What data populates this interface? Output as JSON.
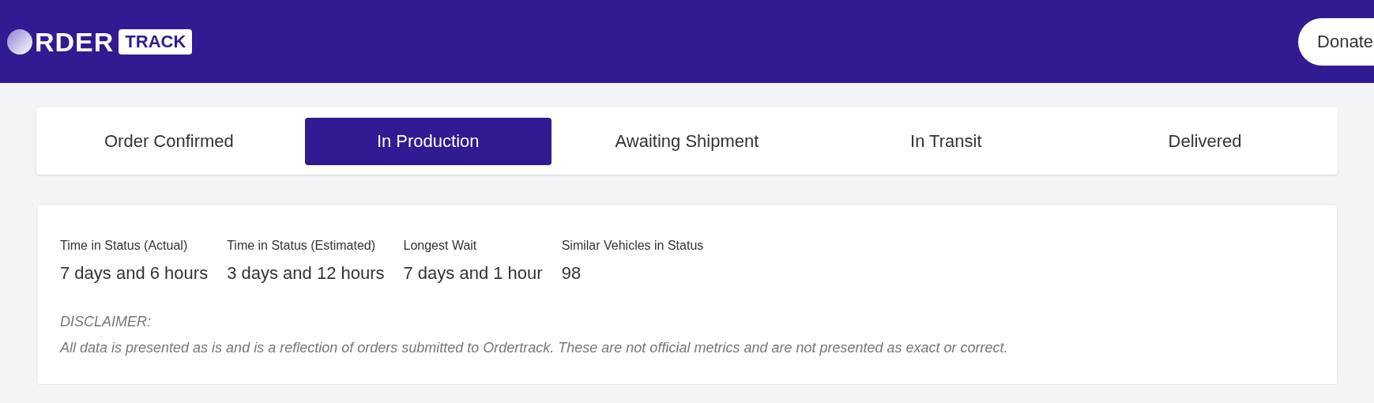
{
  "header": {
    "logo": {
      "word": "RDER",
      "badge": "TRACK"
    },
    "donate": "Donate"
  },
  "tabs": [
    {
      "label": "Order Confirmed",
      "selected": false
    },
    {
      "label": "In Production",
      "selected": true
    },
    {
      "label": "Awaiting Shipment",
      "selected": false
    },
    {
      "label": "In Transit",
      "selected": false
    },
    {
      "label": "Delivered",
      "selected": false
    }
  ],
  "stats": [
    {
      "label": "Time in Status (Actual)",
      "value": "7 days and 6 hours"
    },
    {
      "label": "Time in Status (Estimated)",
      "value": "3 days and 12 hours"
    },
    {
      "label": "Longest Wait",
      "value": "7 days and 1 hour"
    },
    {
      "label": "Similar Vehicles in Status",
      "value": "98"
    }
  ],
  "disclaimer": {
    "title": "DISCLAIMER:",
    "text": "All data is presented as is and is a reflection of orders submitted to Ordertrack. These are not official metrics and are not presented as exact or correct."
  }
}
